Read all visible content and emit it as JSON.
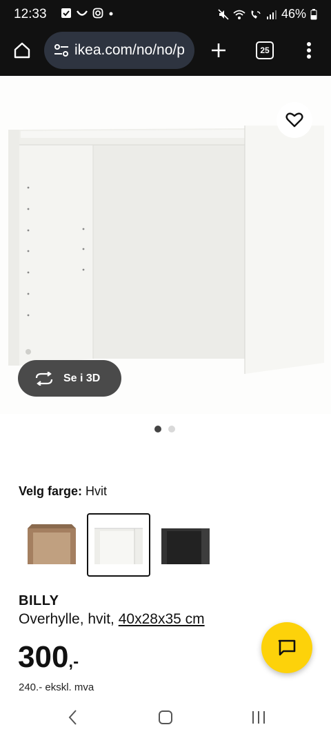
{
  "status_bar": {
    "time": "12:33",
    "battery": "46%"
  },
  "browser": {
    "url": "ikea.com/no/no/p",
    "tab_count": "25"
  },
  "gallery": {
    "see_3d_label": "Se i 3D",
    "slide_count": 2,
    "active_slide": 1
  },
  "color_picker": {
    "label": "Velg farge:",
    "selected_value": "Hvit",
    "swatches": [
      {
        "name": "walnut",
        "color": "#a47f60"
      },
      {
        "name": "white",
        "color": "#f2f2ee"
      },
      {
        "name": "black-brown",
        "color": "#3a3a3a"
      }
    ],
    "selected_index": 1
  },
  "product": {
    "name": "BILLY",
    "description": "Overhylle, hvit,",
    "dimensions": "40x28x35 cm",
    "price_main": "300",
    "price_suffix": ",-",
    "price_ex_vat": "240.- ekskl. mva"
  },
  "colors": {
    "accent_yellow": "#fdd20a",
    "dark": "#111111"
  }
}
